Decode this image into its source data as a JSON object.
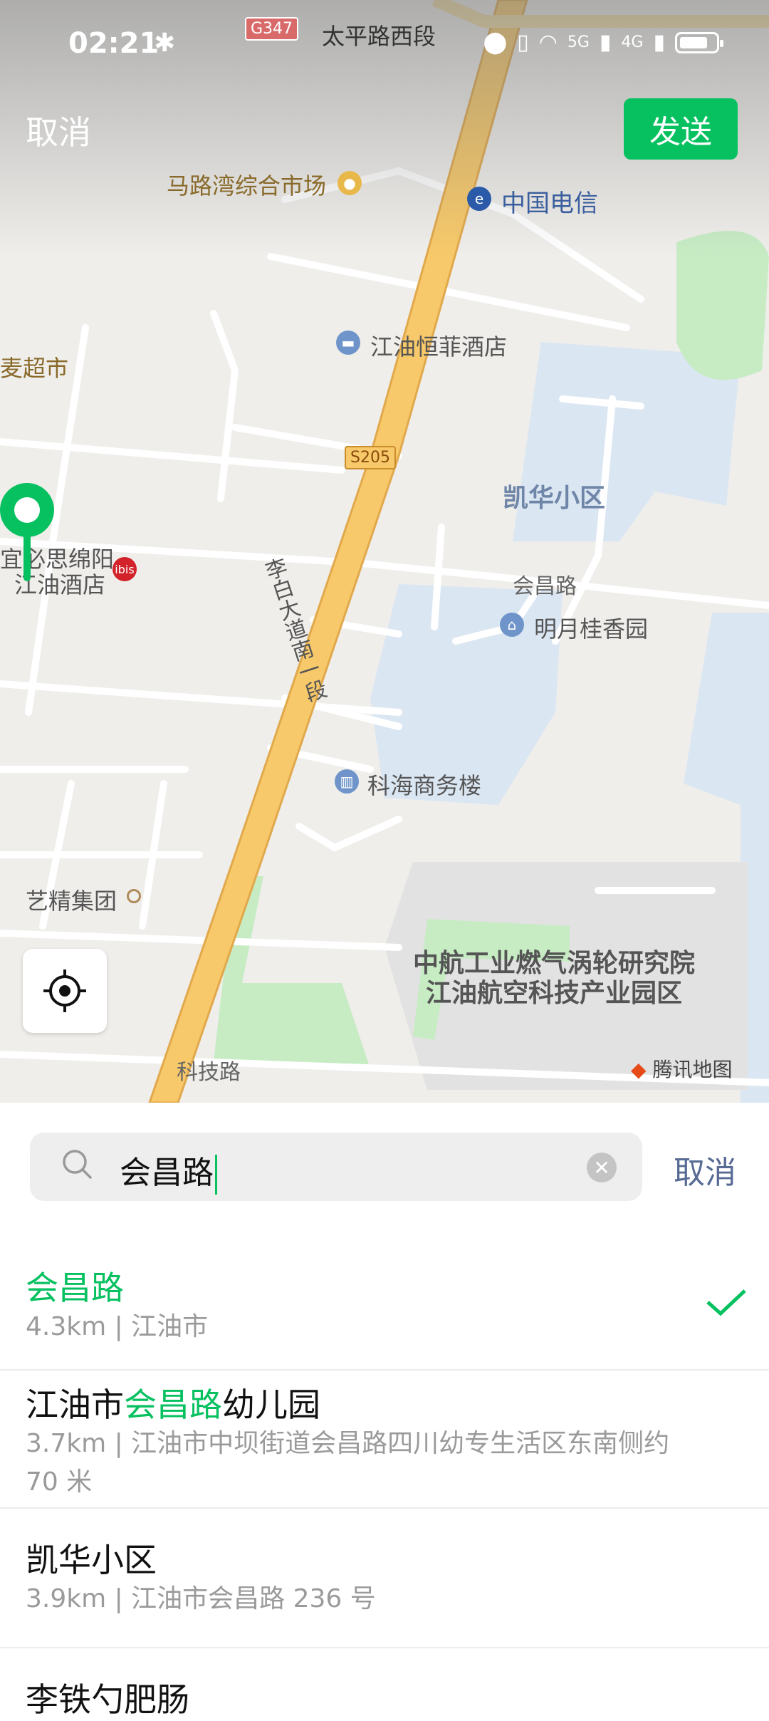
{
  "status_bar": {
    "time": "02:21",
    "network_labels": [
      "5G",
      "4G"
    ]
  },
  "header": {
    "cancel_label": "取消",
    "send_label": "发送"
  },
  "map": {
    "road_shields": [
      "G347",
      "S205"
    ],
    "labels": {
      "taiping_road": "太平路西段",
      "malu_market": "马路湾综合市场",
      "china_telecom": "中国电信",
      "supermarket": "麦超市",
      "hengfei_hotel": "江油恒菲酒店",
      "kaihua": "凯华小区",
      "huichang_road": "会昌路",
      "mingyue": "明月桂香园",
      "ibis_line1": "宜必思绵阳",
      "ibis_line2": "江油酒店",
      "libai_road": "李白大道南一段",
      "kehai": "科海商务楼",
      "yijing": "艺精集团",
      "avic_line1": "中航工业燃气涡轮研究院",
      "avic_line2": "江油航空科技产业园区",
      "keji_road": "科技路",
      "ibis_badge": "ibis"
    },
    "provider": "腾讯地图"
  },
  "search": {
    "query": "会昌路",
    "cancel_label": "取消"
  },
  "results": [
    {
      "title_pre": "",
      "title_hl": "会昌路",
      "title_post": "",
      "sub": "4.3km | 江油市",
      "selected": true
    },
    {
      "title_pre": "江油市",
      "title_hl": "会昌路",
      "title_post": "幼儿园",
      "sub": "3.7km | 江油市中坝街道会昌路四川幼专生活区东南侧约 70 米",
      "selected": false
    },
    {
      "title_pre": "凯华小区",
      "title_hl": "",
      "title_post": "",
      "sub": "3.9km | 江油市会昌路 236 号",
      "selected": false
    },
    {
      "title_pre": "李铁勺肥肠",
      "title_hl": "",
      "title_post": "",
      "sub": "",
      "selected": false
    }
  ],
  "colors": {
    "accent_green": "#07c160",
    "link_blue": "#576b95",
    "map_bg": "#efeeeb",
    "main_road": "#f7c96a"
  }
}
